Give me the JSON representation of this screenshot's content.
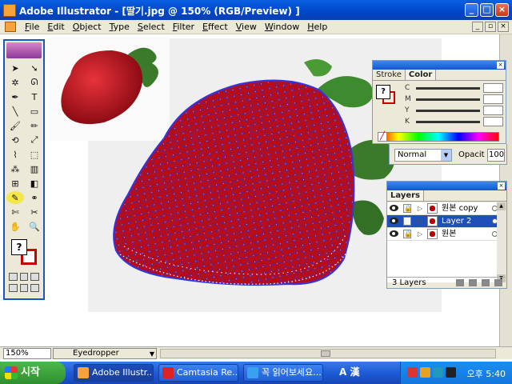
{
  "window": {
    "title": "Adobe Illustrator - [딸기.jpg @ 150% (RGB/Preview) ]",
    "minimize": "_",
    "maximize": "□",
    "close": "×"
  },
  "menu": {
    "items": [
      "File",
      "Edit",
      "Object",
      "Type",
      "Select",
      "Filter",
      "Effect",
      "View",
      "Window",
      "Help"
    ],
    "mdi_minimize": "_",
    "mdi_restore": "▫",
    "mdi_close": "×"
  },
  "toolbox": {
    "tools": [
      {
        "name": "selection-tool",
        "glyph": "➤"
      },
      {
        "name": "direct-selection-tool",
        "glyph": "➘"
      },
      {
        "name": "magic-wand-tool",
        "glyph": "✲"
      },
      {
        "name": "lasso-tool",
        "glyph": "ᘏ"
      },
      {
        "name": "pen-tool",
        "glyph": "✒"
      },
      {
        "name": "type-tool",
        "glyph": "T"
      },
      {
        "name": "line-tool",
        "glyph": "╲"
      },
      {
        "name": "rectangle-tool",
        "glyph": "▭"
      },
      {
        "name": "paintbrush-tool",
        "glyph": "🖌"
      },
      {
        "name": "pencil-tool",
        "glyph": "✏"
      },
      {
        "name": "rotate-tool",
        "glyph": "⟲"
      },
      {
        "name": "scale-tool",
        "glyph": "⤢"
      },
      {
        "name": "warp-tool",
        "glyph": "⌇"
      },
      {
        "name": "free-transform-tool",
        "glyph": "⬚"
      },
      {
        "name": "symbol-sprayer-tool",
        "glyph": "⁂"
      },
      {
        "name": "column-graph-tool",
        "glyph": "▥"
      },
      {
        "name": "mesh-tool",
        "glyph": "⊞"
      },
      {
        "name": "gradient-tool",
        "glyph": "◧"
      },
      {
        "name": "eyedropper-tool",
        "glyph": "✎",
        "active": true
      },
      {
        "name": "blend-tool",
        "glyph": "⚭"
      },
      {
        "name": "slice-tool",
        "glyph": "✄"
      },
      {
        "name": "scissors-tool",
        "glyph": "✂"
      },
      {
        "name": "hand-tool",
        "glyph": "✋"
      },
      {
        "name": "zoom-tool",
        "glyph": "🔍"
      }
    ],
    "fill_glyph": "?"
  },
  "color_panel": {
    "tabs": [
      "Stroke",
      "Color"
    ],
    "active_tab": "Color",
    "channels": [
      "C",
      "M",
      "Y",
      "K"
    ],
    "fill_glyph": "?"
  },
  "transparency": {
    "blend_mode": "Normal",
    "opacity_label": "Opacit",
    "opacity_value": "100"
  },
  "layers_panel": {
    "tab": "Layers",
    "layers": [
      {
        "name": "원본 copy",
        "visible": true,
        "locked": true,
        "selected": false
      },
      {
        "name": "Layer 2",
        "visible": true,
        "locked": false,
        "selected": true
      },
      {
        "name": "원본",
        "visible": true,
        "locked": true,
        "selected": false
      }
    ],
    "footer": "3 Layers"
  },
  "status": {
    "zoom": "150%",
    "tool": "Eyedropper"
  },
  "taskbar": {
    "start": "시작",
    "tasks": [
      {
        "label": "Adobe Illustr...",
        "active": true,
        "color": "#f7a23b"
      },
      {
        "label": "Camtasia Re...",
        "active": false,
        "color": "#d22"
      },
      {
        "label": "꼭 읽어보세요...",
        "active": false,
        "color": "#3aa0f0"
      }
    ],
    "ime": "A 漢",
    "clock": "오후 5:40"
  },
  "colors": {
    "strawberry_mesh": "#b50d1a",
    "mesh_lines": "#2a2ad8",
    "leaf": "#3a7a2a"
  }
}
